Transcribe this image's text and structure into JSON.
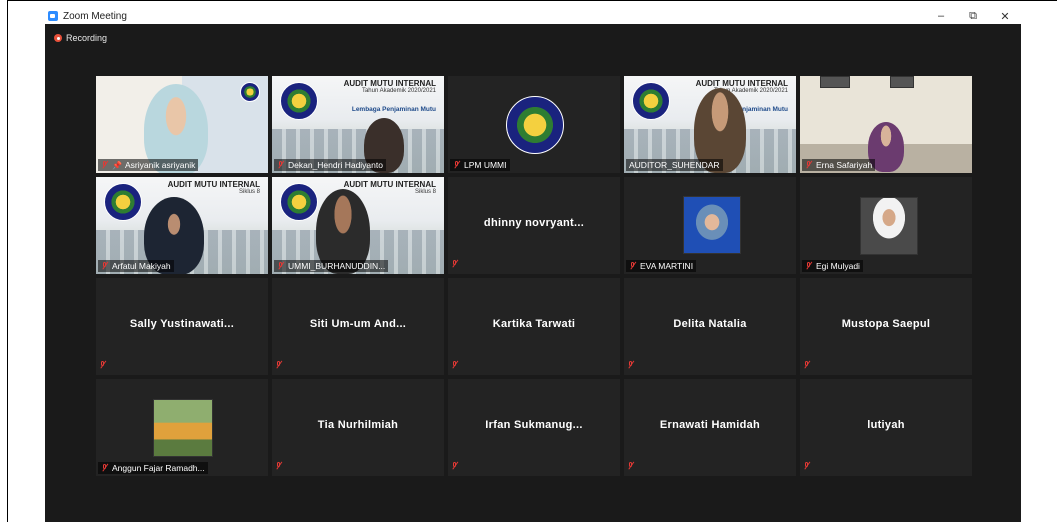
{
  "window": {
    "title": "Zoom Meeting",
    "controls": [
      "–",
      "⧉",
      "✕"
    ]
  },
  "recording": {
    "label": "Recording"
  },
  "tiles": [
    {
      "name": "Asriyanik asriyanik",
      "has_video": true,
      "pinned": true
    },
    {
      "name": "Dekan_Hendri Hadiyanto",
      "has_video": true
    },
    {
      "name": "LPM UMMI",
      "has_video": true
    },
    {
      "name": "AUDITOR_SUHENDAR",
      "has_video": true,
      "active_speaker": true
    },
    {
      "name": "Erna Safariyah",
      "has_video": true
    },
    {
      "name": "Arfatul Makiyah",
      "has_video": true
    },
    {
      "name": "UMMI_BURHANUDDIN...",
      "has_video": true
    },
    {
      "display": "dhinny novryant...",
      "has_video": false
    },
    {
      "name": "EVA MARTINI",
      "has_video": true
    },
    {
      "name": "Egi Mulyadi",
      "has_video": true
    },
    {
      "display": "Sally Yustinawati...",
      "has_video": false
    },
    {
      "display": "Siti Um-um And...",
      "has_video": false
    },
    {
      "display": "Kartika Tarwati",
      "has_video": false
    },
    {
      "display": "Delita Natalia",
      "has_video": false
    },
    {
      "display": "Mustopa Saepul",
      "has_video": false
    },
    {
      "name": "Anggun Fajar Ramadh...",
      "has_video": true
    },
    {
      "display": "Tia Nurhilmiah",
      "has_video": false
    },
    {
      "display": "Irfan Sukmanug...",
      "has_video": false
    },
    {
      "display": "Ernawati Hamidah",
      "has_video": false
    },
    {
      "display": "lutiyah",
      "has_video": false
    }
  ],
  "slide": {
    "title": "AUDIT MUTU INTERNAL",
    "siklus": "Siklus 8",
    "tahun": "Tahun Akademik 2020/2021",
    "lembaga": "Lembaga Penjaminan Mutu"
  },
  "colors": {
    "active_border": "#f4e56a",
    "mute_red": "#e53935",
    "tile_bg": "#232323"
  }
}
